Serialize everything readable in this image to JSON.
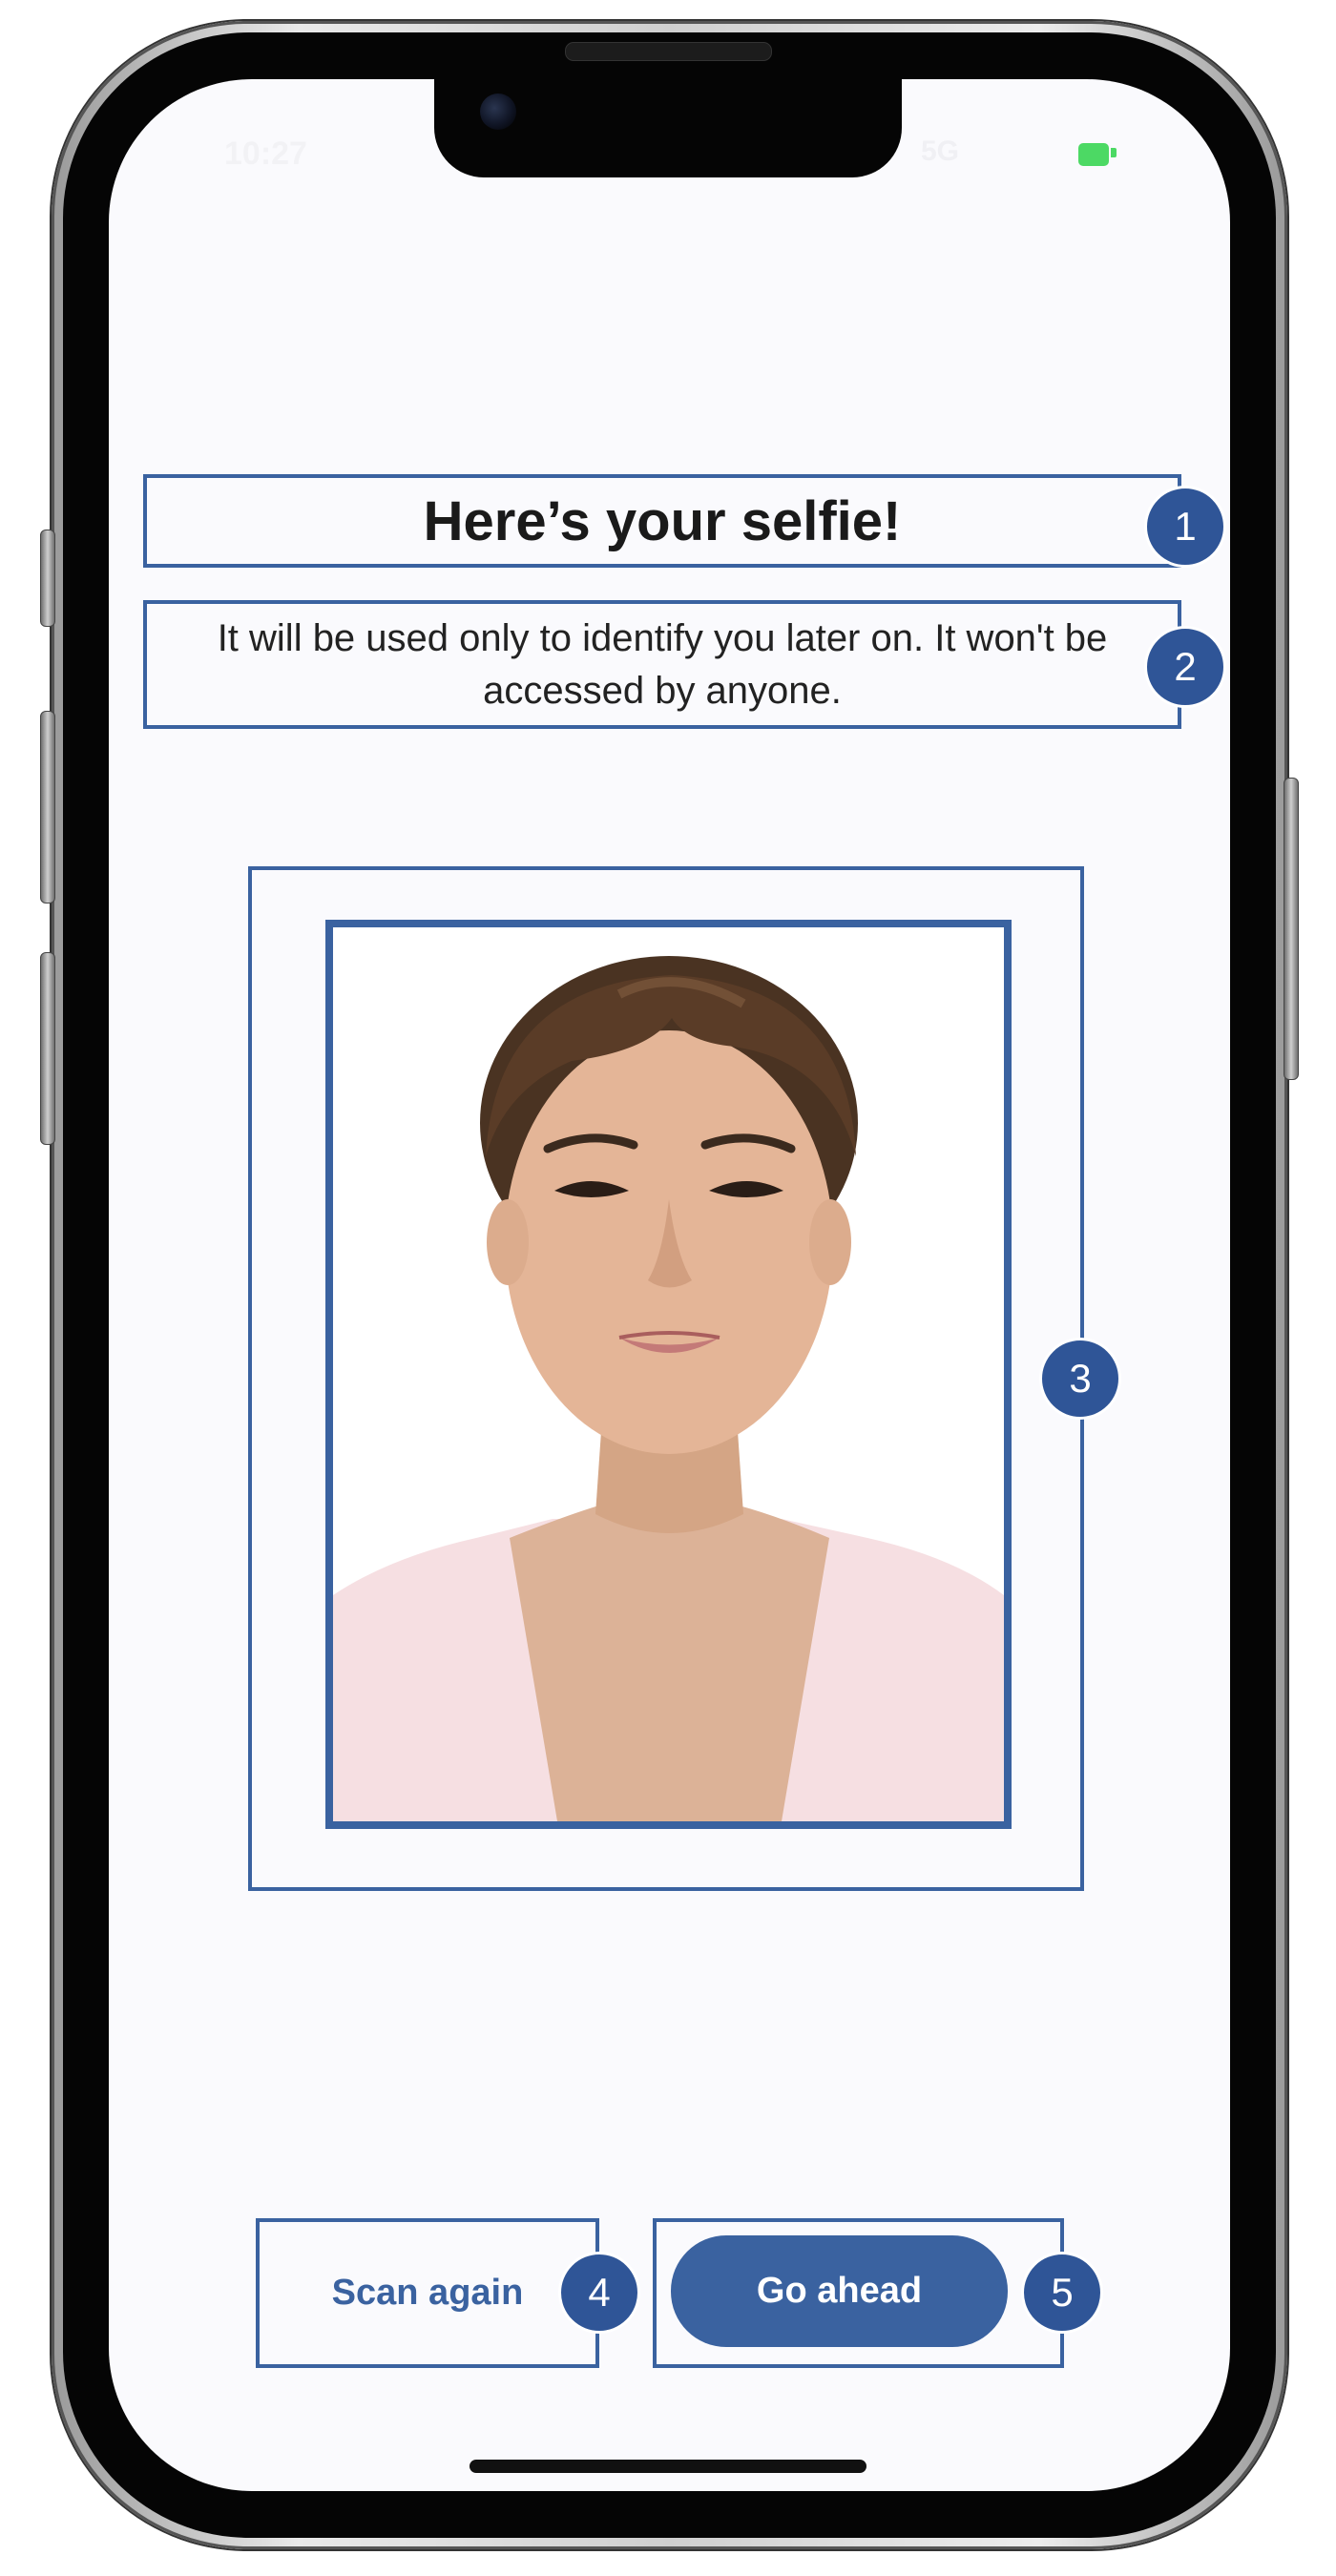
{
  "status_bar": {
    "time": "10:27",
    "signal": "5G",
    "battery_color": "#4cd964"
  },
  "screen": {
    "title": "Here’s your selfie!",
    "subtitle": "It will be used only to identify you later on. It won't be accessed by anyone.",
    "photo_alt": "Selfie photo of a smiling woman"
  },
  "actions": {
    "scan_again_label": "Scan again",
    "go_ahead_label": "Go ahead"
  },
  "annotations": {
    "badge_1": "1",
    "badge_2": "2",
    "badge_3": "3",
    "badge_4": "4",
    "badge_5": "5"
  },
  "colors": {
    "accent": "#3a62a0",
    "badge": "#2f5597",
    "screen_background": "#fafafd"
  }
}
